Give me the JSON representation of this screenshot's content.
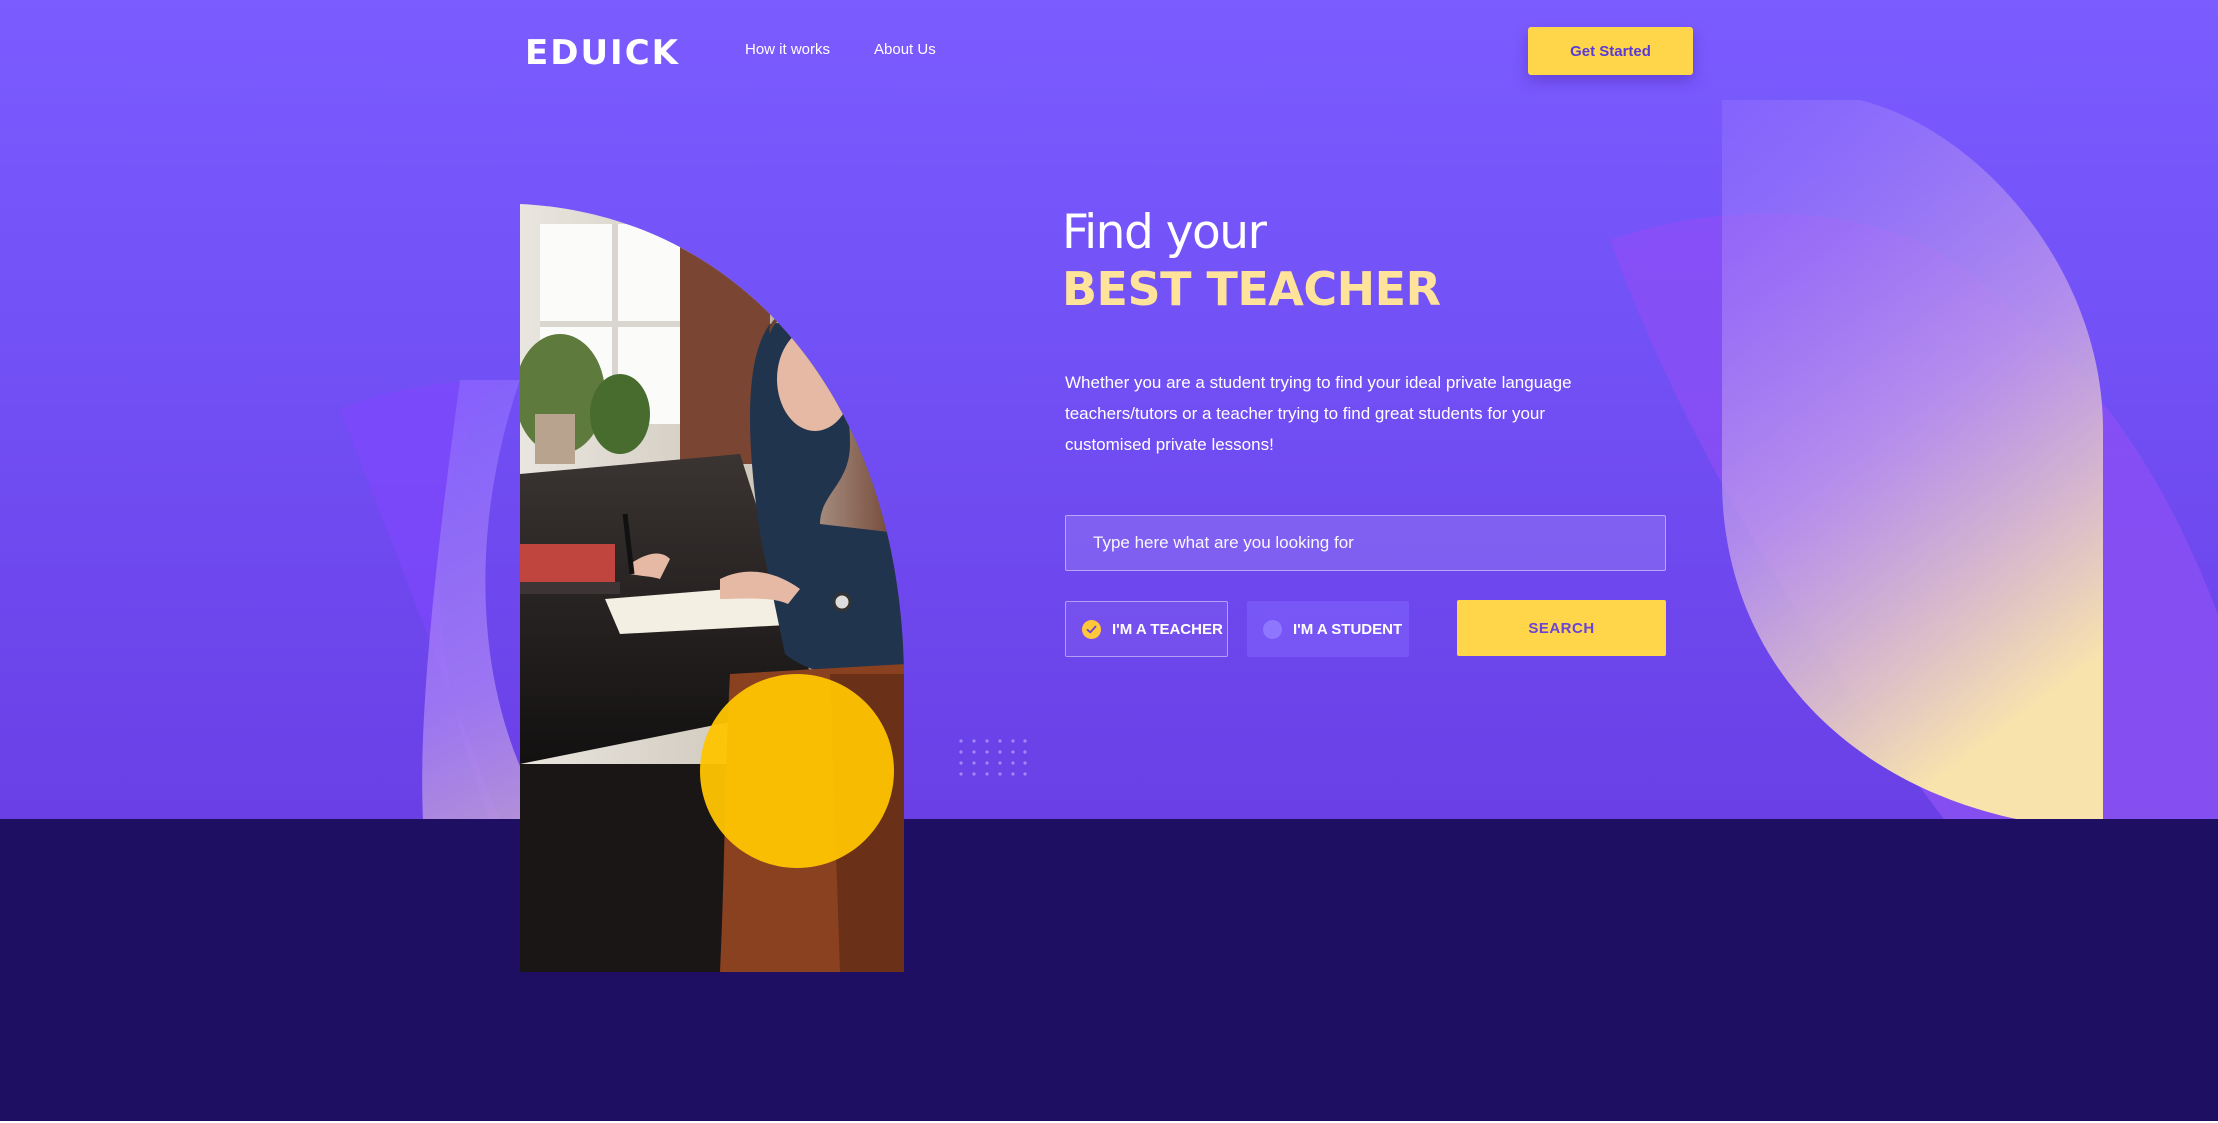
{
  "header": {
    "logo": "EDUICK",
    "nav": [
      "How it works",
      "About Us"
    ],
    "cta_label": "Get Started"
  },
  "hero": {
    "title_line1": "Find your",
    "title_line2": "BEST TEACHER",
    "description": "Whether you are a student trying to find your ideal private language teachers/tutors or a teacher trying to find great students for your customised private lessons!",
    "search": {
      "placeholder": "Type here what are you looking for"
    },
    "roles": [
      {
        "label": "I'M A TEACHER",
        "selected": true
      },
      {
        "label": "I'M A STUDENT",
        "selected": false
      }
    ],
    "search_label": "SEARCH"
  },
  "icons": {
    "selected_role_indicator": "check-circle-icon",
    "unselected_role_indicator": "radio-empty-icon"
  },
  "colors": {
    "brand_purple": "#7b5cff",
    "accent_yellow": "#ffd54a",
    "highlight_cream": "#ffe39a",
    "footer_navy": "#1e0f63"
  }
}
